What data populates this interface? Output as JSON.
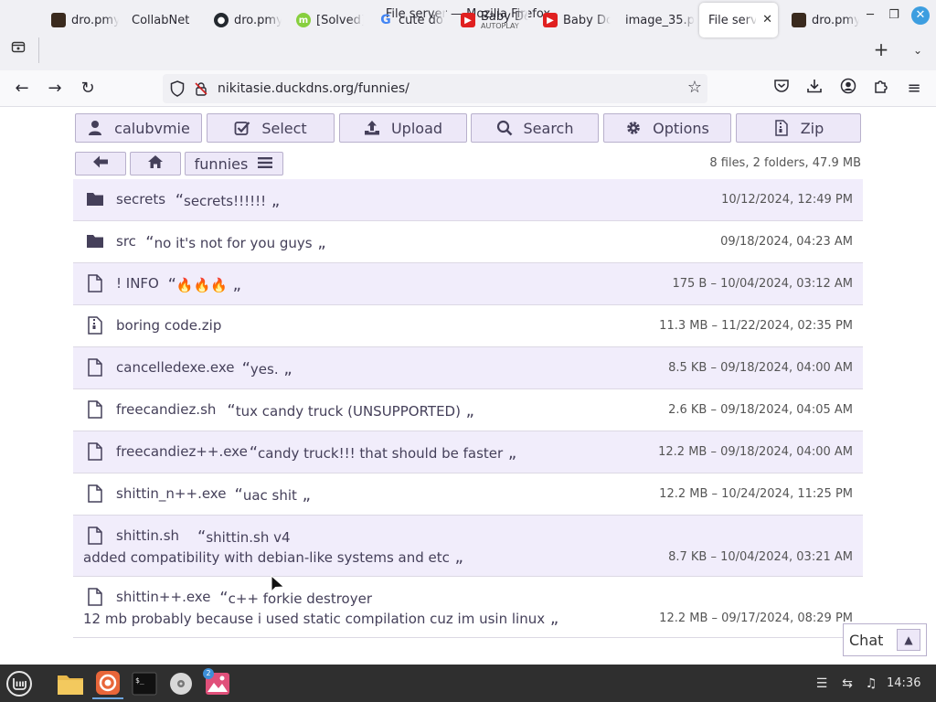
{
  "window": {
    "title": "File server — Mozilla Firefox"
  },
  "tabs": [
    {
      "label": "dro.pmy",
      "favicon": "dark-square"
    },
    {
      "label": "CollabNet",
      "favicon": "none"
    },
    {
      "label": "dro.pmy",
      "favicon": "github"
    },
    {
      "label": "[Solved]",
      "favicon": "linuxmint"
    },
    {
      "label": "cute do",
      "favicon": "google"
    },
    {
      "label": "Baby Do",
      "sub": "AUTOPLAY",
      "favicon": "youtube"
    },
    {
      "label": "Baby Do",
      "favicon": "youtube"
    },
    {
      "label": "image_35.p",
      "favicon": "none"
    },
    {
      "label": "File serve",
      "favicon": "none",
      "active": true
    },
    {
      "label": "dro.pmy",
      "favicon": "dark-square"
    }
  ],
  "nav": {
    "url": "nikitasie.duckdns.org/funnies/"
  },
  "toolbar": {
    "user": "calubvmie",
    "select": "Select",
    "upload": "Upload",
    "search": "Search",
    "options": "Options",
    "zip": "Zip"
  },
  "breadcrumb": {
    "folder": "funnies",
    "summary": "8 files, 2 folders, 47.9 MB"
  },
  "files": [
    {
      "name": "secrets",
      "desc": "secrets!!!!!!",
      "meta": "10/12/2024, 12:49 PM",
      "icon": "folder"
    },
    {
      "name": "src",
      "desc": "no it's not for you guys",
      "meta": "09/18/2024, 04:23 AM",
      "icon": "folder"
    },
    {
      "name": "! INFO",
      "desc": "🔥🔥🔥",
      "meta": "175 B – 10/04/2024, 03:12 AM",
      "icon": "file"
    },
    {
      "name": "boring code.zip",
      "desc": "",
      "meta": "11.3 MB – 11/22/2024, 02:35 PM",
      "icon": "zip"
    },
    {
      "name": "cancelledexe.exe",
      "desc": "yes.",
      "meta": "8.5 KB – 09/18/2024, 04:00 AM",
      "icon": "file"
    },
    {
      "name": "freecandiez.sh",
      "desc": "tux candy truck (UNSUPPORTED)",
      "meta": "2.6 KB – 09/18/2024, 04:05 AM",
      "icon": "file"
    },
    {
      "name": "freecandiez++.exe",
      "desc": "candy truck!!! that should be faster",
      "meta": "12.2 MB – 09/18/2024, 04:00 AM",
      "icon": "file"
    },
    {
      "name": "shittin_n++.exe",
      "desc": "uac shit",
      "meta": "12.2 MB – 10/24/2024, 11:25 PM",
      "icon": "file"
    },
    {
      "name": "shittin.sh",
      "desc": "shittin.sh v4",
      "desc2": "added compatibility with debian-like systems and etc",
      "meta": "8.7 KB – 10/04/2024, 03:21 AM",
      "icon": "file"
    },
    {
      "name": "shittin++.exe",
      "desc": "c++ forkie destroyer",
      "desc2": "12 mb probably because i used static compilation cuz im usin linux",
      "meta": "12.2 MB – 09/17/2024, 08:29 PM",
      "icon": "file"
    }
  ],
  "chat": {
    "label": "Chat",
    "toggle": "▲"
  },
  "taskbar": {
    "clock": "14:36",
    "badge": "2"
  },
  "colors": {
    "accent": "#45405a",
    "row_alt": "#f1edfb",
    "button_bg": "#ede8f8"
  }
}
